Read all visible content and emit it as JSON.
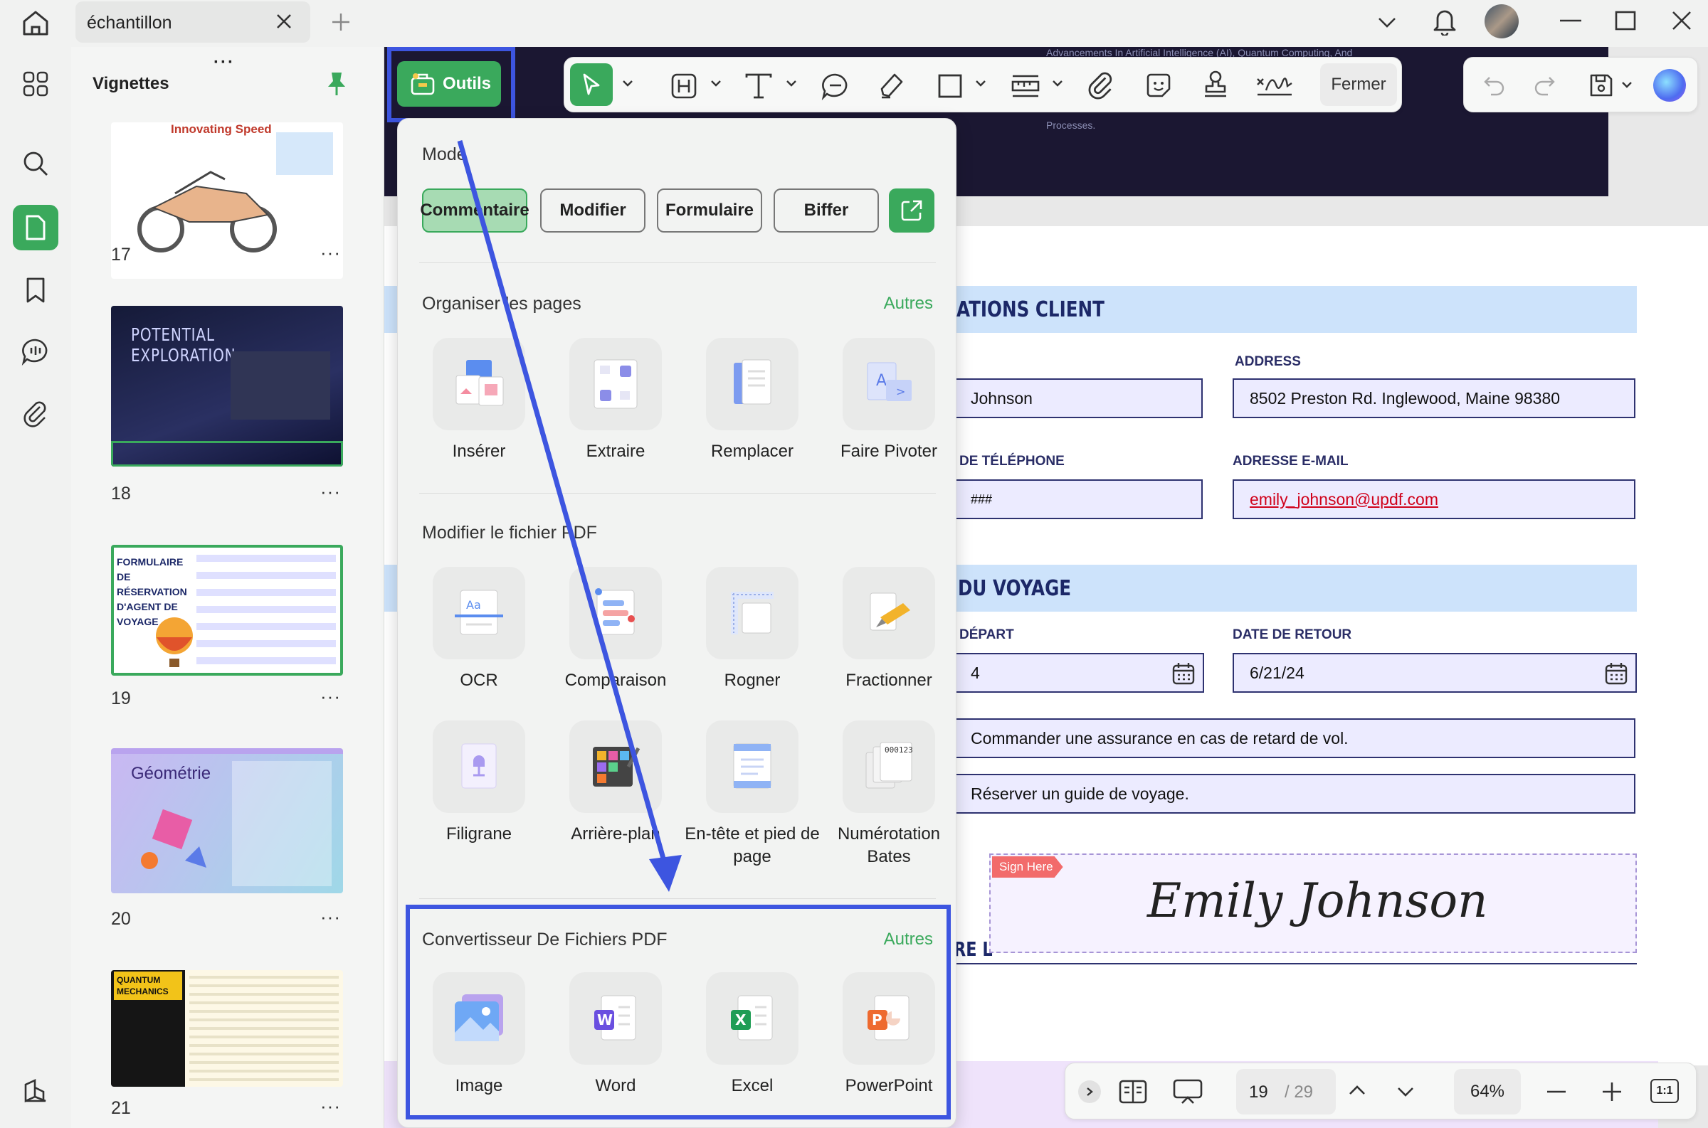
{
  "titlebar": {
    "tab_label": "échantillon"
  },
  "thumbnails": {
    "panel_title": "Vignettes",
    "pages": [
      {
        "num": "17",
        "caption": "Innovating Speed"
      },
      {
        "num": "18",
        "caption": "POTENTIAL EXPLORATION"
      },
      {
        "num": "19",
        "caption": "FORMULAIRE DE RÉSERVATION D'AGENT DE VOYAGE"
      },
      {
        "num": "20",
        "caption": "Géométrie"
      },
      {
        "num": "21",
        "caption": "QUANTUM MECHANICS"
      }
    ],
    "more": "···"
  },
  "toolbar": {
    "outils_label": "Outils",
    "fermer_label": "Fermer"
  },
  "tools_menu": {
    "mode_title": "Mode",
    "modes": [
      "Commentaire",
      "Modifier",
      "Formulaire",
      "Biffer"
    ],
    "organize_title": "Organiser les pages",
    "organize_more": "Autres",
    "organize_items": [
      "Insérer",
      "Extraire",
      "Remplacer",
      "Faire Pivoter"
    ],
    "modify_title": "Modifier le fichier PDF",
    "modify_items": [
      "OCR",
      "Comparaison",
      "Rogner",
      "Fractionner",
      "Filigrane",
      "Arrière-plan",
      "En-tête et pied de page",
      "Numérotation Bates"
    ],
    "convert_title": "Convertisseur De Fichiers PDF",
    "convert_more": "Autres",
    "convert_items": [
      "Image",
      "Word",
      "Excel",
      "PowerPoint"
    ]
  },
  "document": {
    "banner_text": "Advancements In Artificial Intelligence (AI), Quantum Computing, And",
    "banner_text2": "Processes.",
    "section1": "ATIONS CLIENT",
    "address_label": "ADDRESS",
    "name_value": "Johnson",
    "address_value": "8502 Preston Rd. Inglewood, Maine 98380",
    "phone_label": "DE TÉLÉPHONE",
    "phone_value": "###",
    "email_label": "ADRESSE E-MAIL",
    "email_value": "emily_johnson@updf.com",
    "section2": "DU VOYAGE",
    "depart_label": "DÉPART",
    "depart_value": "4",
    "return_label": "DATE DE RETOUR",
    "return_value": "6/21/24",
    "option1": "Commander une assurance en cas de retard de vol.",
    "option2": "Réserver un guide de voyage.",
    "sign_here": "Sign Here",
    "signature": "Emily Johnson",
    "sig_label_fragment": "RE L"
  },
  "bottombar": {
    "page_current": "19",
    "page_total": "/ 29",
    "zoom": "64%",
    "fit_label": "1:1"
  },
  "colors": {
    "accent_green": "#3aa95c",
    "highlight_blue": "#3d55e0",
    "form_navy": "#2e3270"
  }
}
